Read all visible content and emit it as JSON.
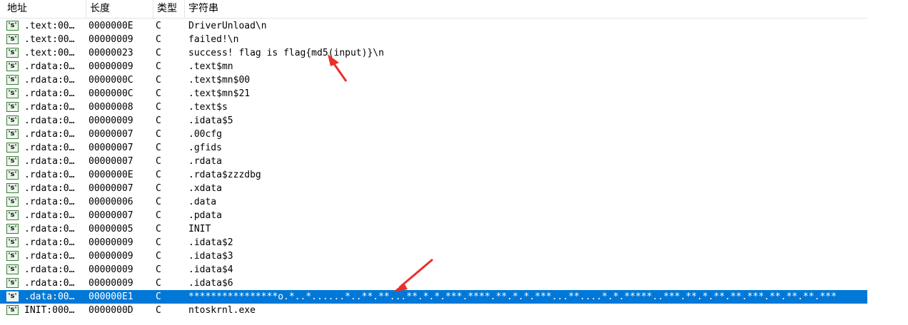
{
  "columns": {
    "address": "地址",
    "length": "长度",
    "type": "类型",
    "string": "字符串"
  },
  "rows": [
    {
      "icon": "'s'",
      "address": ".text:00…",
      "length": "0000000E",
      "type": "C",
      "string": "DriverUnload\\n"
    },
    {
      "icon": "'s'",
      "address": ".text:00…",
      "length": "00000009",
      "type": "C",
      "string": "failed!\\n"
    },
    {
      "icon": "'s'",
      "address": ".text:00…",
      "length": "00000023",
      "type": "C",
      "string": "success! flag is flag{md5(input)}\\n"
    },
    {
      "icon": "'s'",
      "address": ".rdata:0…",
      "length": "00000009",
      "type": "C",
      "string": ".text$mn"
    },
    {
      "icon": "'s'",
      "address": ".rdata:0…",
      "length": "0000000C",
      "type": "C",
      "string": ".text$mn$00"
    },
    {
      "icon": "'s'",
      "address": ".rdata:0…",
      "length": "0000000C",
      "type": "C",
      "string": ".text$mn$21"
    },
    {
      "icon": "'s'",
      "address": ".rdata:0…",
      "length": "00000008",
      "type": "C",
      "string": ".text$s"
    },
    {
      "icon": "'s'",
      "address": ".rdata:0…",
      "length": "00000009",
      "type": "C",
      "string": ".idata$5"
    },
    {
      "icon": "'s'",
      "address": ".rdata:0…",
      "length": "00000007",
      "type": "C",
      "string": ".00cfg"
    },
    {
      "icon": "'s'",
      "address": ".rdata:0…",
      "length": "00000007",
      "type": "C",
      "string": ".gfids"
    },
    {
      "icon": "'s'",
      "address": ".rdata:0…",
      "length": "00000007",
      "type": "C",
      "string": ".rdata"
    },
    {
      "icon": "'s'",
      "address": ".rdata:0…",
      "length": "0000000E",
      "type": "C",
      "string": ".rdata$zzzdbg"
    },
    {
      "icon": "'s'",
      "address": ".rdata:0…",
      "length": "00000007",
      "type": "C",
      "string": ".xdata"
    },
    {
      "icon": "'s'",
      "address": ".rdata:0…",
      "length": "00000006",
      "type": "C",
      "string": ".data"
    },
    {
      "icon": "'s'",
      "address": ".rdata:0…",
      "length": "00000007",
      "type": "C",
      "string": ".pdata"
    },
    {
      "icon": "'s'",
      "address": ".rdata:0…",
      "length": "00000005",
      "type": "C",
      "string": "INIT"
    },
    {
      "icon": "'s'",
      "address": ".rdata:0…",
      "length": "00000009",
      "type": "C",
      "string": ".idata$2"
    },
    {
      "icon": "'s'",
      "address": ".rdata:0…",
      "length": "00000009",
      "type": "C",
      "string": ".idata$3"
    },
    {
      "icon": "'s'",
      "address": ".rdata:0…",
      "length": "00000009",
      "type": "C",
      "string": ".idata$4"
    },
    {
      "icon": "'s'",
      "address": ".rdata:0…",
      "length": "00000009",
      "type": "C",
      "string": ".idata$6"
    },
    {
      "icon": "'s'",
      "address": ".data:00…",
      "length": "000000E1",
      "type": "C",
      "string": "****************o.*..*......*..**.**...**.*.*.***.****.**.*.*.***...**....*.*.*****..***.**.*.**.**.***.**.**.**.***",
      "selected": true
    },
    {
      "icon": "'s'",
      "address": "INIT:000…",
      "length": "0000000D",
      "type": "C",
      "string": "ntoskrnl.exe"
    }
  ],
  "colors": {
    "selection": "#0078d7",
    "annotation_arrow": "#e8312a"
  }
}
